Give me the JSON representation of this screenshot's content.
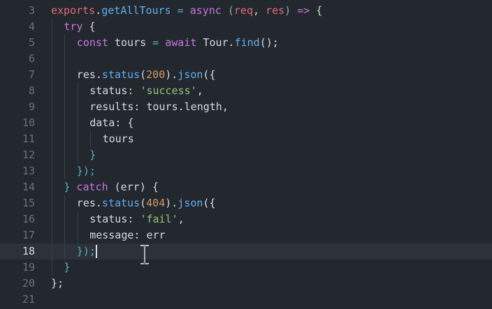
{
  "editor": {
    "current_line": "18",
    "lines": [
      {
        "num": "3",
        "tokens": [
          {
            "t": "exports",
            "c": "param"
          },
          {
            "t": ".",
            "c": "plain"
          },
          {
            "t": "getAllTours",
            "c": "fn"
          },
          {
            "t": " = ",
            "c": "punc"
          },
          {
            "t": "async",
            "c": "kw"
          },
          {
            "t": " (",
            "c": "prm"
          },
          {
            "t": "req",
            "c": "param"
          },
          {
            "t": ", ",
            "c": "plain"
          },
          {
            "t": "res",
            "c": "param"
          },
          {
            "t": ") ",
            "c": "prm"
          },
          {
            "t": "=>",
            "c": "kw"
          },
          {
            "t": " {",
            "c": "plain"
          }
        ]
      },
      {
        "num": "4",
        "tokens": [
          {
            "t": "try",
            "c": "kw"
          },
          {
            "t": " {",
            "c": "plain"
          }
        ]
      },
      {
        "num": "5",
        "tokens": [
          {
            "t": "const",
            "c": "kw"
          },
          {
            "t": " tours ",
            "c": "plain"
          },
          {
            "t": "=",
            "c": "punc"
          },
          {
            "t": " await",
            "c": "kw"
          },
          {
            "t": " Tour",
            "c": "plain"
          },
          {
            "t": ".",
            "c": "plain"
          },
          {
            "t": "find",
            "c": "fn"
          },
          {
            "t": "();",
            "c": "plain"
          }
        ]
      },
      {
        "num": "6",
        "tokens": []
      },
      {
        "num": "7",
        "tokens": [
          {
            "t": "res",
            "c": "plain"
          },
          {
            "t": ".",
            "c": "plain"
          },
          {
            "t": "status",
            "c": "fn"
          },
          {
            "t": "(",
            "c": "plain"
          },
          {
            "t": "200",
            "c": "num"
          },
          {
            "t": ").",
            "c": "plain"
          },
          {
            "t": "json",
            "c": "fn"
          },
          {
            "t": "({",
            "c": "plain"
          }
        ]
      },
      {
        "num": "8",
        "tokens": [
          {
            "t": "status",
            "c": "prop"
          },
          {
            "t": ": ",
            "c": "plain"
          },
          {
            "t": "'success'",
            "c": "str"
          },
          {
            "t": ",",
            "c": "plain"
          }
        ]
      },
      {
        "num": "9",
        "tokens": [
          {
            "t": "results",
            "c": "prop"
          },
          {
            "t": ": ",
            "c": "plain"
          },
          {
            "t": "tours",
            "c": "plain"
          },
          {
            "t": ".",
            "c": "plain"
          },
          {
            "t": "length",
            "c": "plain"
          },
          {
            "t": ",",
            "c": "plain"
          }
        ]
      },
      {
        "num": "10",
        "tokens": [
          {
            "t": "data",
            "c": "prop"
          },
          {
            "t": ": {",
            "c": "plain"
          }
        ]
      },
      {
        "num": "11",
        "tokens": [
          {
            "t": "tours",
            "c": "plain"
          }
        ]
      },
      {
        "num": "12",
        "tokens": [
          {
            "t": "}",
            "c": "punc"
          }
        ]
      },
      {
        "num": "13",
        "tokens": [
          {
            "t": "});",
            "c": "punc"
          }
        ]
      },
      {
        "num": "14",
        "tokens": [
          {
            "t": "}",
            "c": "punc"
          },
          {
            "t": " catch",
            "c": "kw"
          },
          {
            "t": " (err) ",
            "c": "plain"
          },
          {
            "t": "{",
            "c": "plain"
          }
        ]
      },
      {
        "num": "15",
        "tokens": [
          {
            "t": "res",
            "c": "plain"
          },
          {
            "t": ".",
            "c": "plain"
          },
          {
            "t": "status",
            "c": "fn"
          },
          {
            "t": "(",
            "c": "plain"
          },
          {
            "t": "404",
            "c": "num"
          },
          {
            "t": ").",
            "c": "plain"
          },
          {
            "t": "json",
            "c": "fn"
          },
          {
            "t": "({",
            "c": "plain"
          }
        ]
      },
      {
        "num": "16",
        "tokens": [
          {
            "t": "status",
            "c": "prop"
          },
          {
            "t": ": ",
            "c": "plain"
          },
          {
            "t": "'fail'",
            "c": "str"
          },
          {
            "t": ",",
            "c": "plain"
          }
        ]
      },
      {
        "num": "17",
        "tokens": [
          {
            "t": "message",
            "c": "prop"
          },
          {
            "t": ": ",
            "c": "plain"
          },
          {
            "t": "err",
            "c": "plain"
          }
        ]
      },
      {
        "num": "18",
        "tokens": [
          {
            "t": "});",
            "c": "punc"
          }
        ]
      },
      {
        "num": "19",
        "tokens": [
          {
            "t": "}",
            "c": "punc"
          }
        ]
      },
      {
        "num": "20",
        "tokens": [
          {
            "t": "};",
            "c": "plain"
          }
        ]
      },
      {
        "num": "21",
        "tokens": []
      }
    ]
  }
}
